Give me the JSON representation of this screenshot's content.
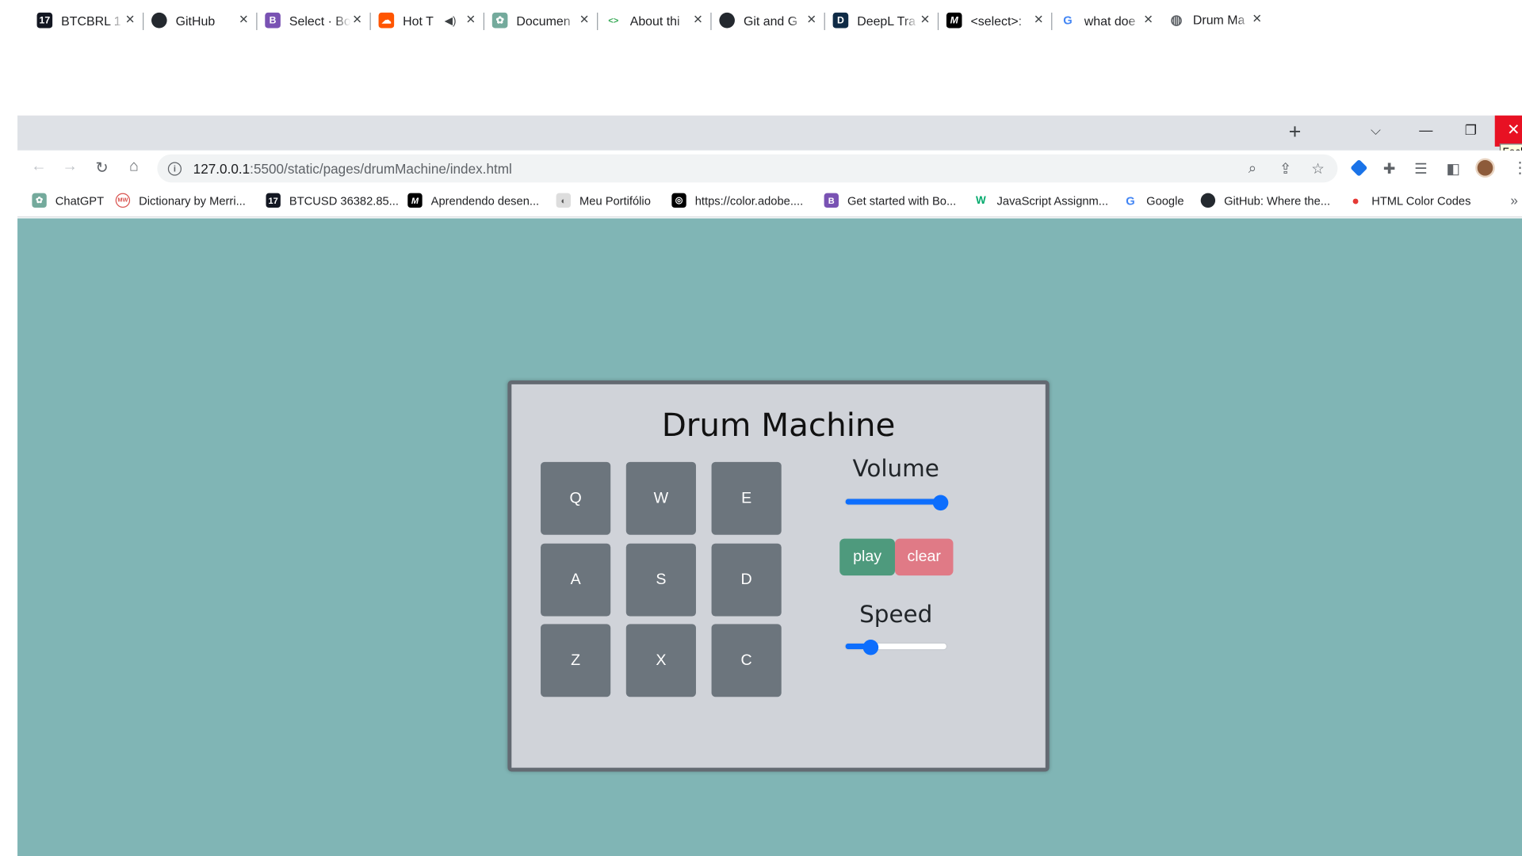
{
  "tabs": [
    {
      "title": "BTCBRL 1",
      "icon": "tradingview-icon",
      "color": "#131722",
      "glyph": "17"
    },
    {
      "title": "GitHub",
      "icon": "github-icon",
      "color": "#24292f",
      "glyph": ""
    },
    {
      "title": "Select · Bo",
      "icon": "bootstrap-icon",
      "color": "#7952b3",
      "glyph": "B"
    },
    {
      "title": "Hot T",
      "icon": "soundcloud-icon",
      "color": "#ff5500",
      "glyph": "☁"
    },
    {
      "title": "Documen",
      "icon": "openai-icon",
      "color": "#74aa9c",
      "glyph": "✿"
    },
    {
      "title": "About thi",
      "icon": "code-icon",
      "color": "#ffffff",
      "glyph": "<>"
    },
    {
      "title": "Git and G",
      "icon": "github-icon",
      "color": "#24292f",
      "glyph": ""
    },
    {
      "title": "DeepL Tra",
      "icon": "deepl-icon",
      "color": "#0f2b46",
      "glyph": "D"
    },
    {
      "title": "<select>:",
      "icon": "mdn-icon",
      "color": "#000000",
      "glyph": "M"
    },
    {
      "title": "what doe",
      "icon": "google-icon",
      "color": "#ffffff",
      "glyph": "G"
    },
    {
      "title": "Drum Ma",
      "icon": "globe-icon",
      "color": "#5f6368",
      "glyph": "◍"
    }
  ],
  "window": {
    "close_tooltip": "Fech"
  },
  "address": {
    "host": "127.0.0.1",
    "rest": ":5500/static/pages/drumMachine/index.html"
  },
  "bookmarks": [
    {
      "label": "ChatGPT",
      "icon": "openai-icon",
      "color": "#74aa9c",
      "glyph": "✿"
    },
    {
      "label": "Dictionary by Merri...",
      "icon": "merriam-webster-icon",
      "color": "#ffffff",
      "glyph": "MW"
    },
    {
      "label": "BTCUSD 36382.85...",
      "icon": "tradingview-icon",
      "color": "#131722",
      "glyph": "17"
    },
    {
      "label": "Aprendendo desen...",
      "icon": "mdn-icon",
      "color": "#000000",
      "glyph": "M"
    },
    {
      "label": "Meu Portifólio",
      "icon": "portfolio-icon",
      "color": "#dddddd",
      "glyph": "◐"
    },
    {
      "label": "https://color.adobe....",
      "icon": "adobe-color-icon",
      "color": "#000000",
      "glyph": "◎"
    },
    {
      "label": "Get started with Bo...",
      "icon": "bootstrap-icon",
      "color": "#7952b3",
      "glyph": "B"
    },
    {
      "label": "JavaScript Assignm...",
      "icon": "w3schools-icon",
      "color": "#ffffff",
      "glyph": "W"
    },
    {
      "label": "Google",
      "icon": "google-icon",
      "color": "#ffffff",
      "glyph": "G"
    },
    {
      "label": "GitHub: Where the...",
      "icon": "github-icon",
      "color": "#24292f",
      "glyph": ""
    },
    {
      "label": "HTML Color Codes",
      "icon": "html-color-codes-icon",
      "color": "#e53935",
      "glyph": "●"
    }
  ],
  "app": {
    "title": "Drum Machine",
    "pads": [
      "Q",
      "W",
      "E",
      "A",
      "S",
      "D",
      "Z",
      "X",
      "C"
    ],
    "volume_label": "Volume",
    "volume_value": 1.0,
    "speed_label": "Speed",
    "speed_value": 0.2,
    "play_label": "play",
    "clear_label": "clear",
    "colors": {
      "background": "#80b5b5",
      "panel": "#d0d3d9",
      "pad": "#6c757d",
      "play": "#4e9a7d",
      "clear": "#e07a86",
      "slider": "#0d6efd"
    }
  }
}
